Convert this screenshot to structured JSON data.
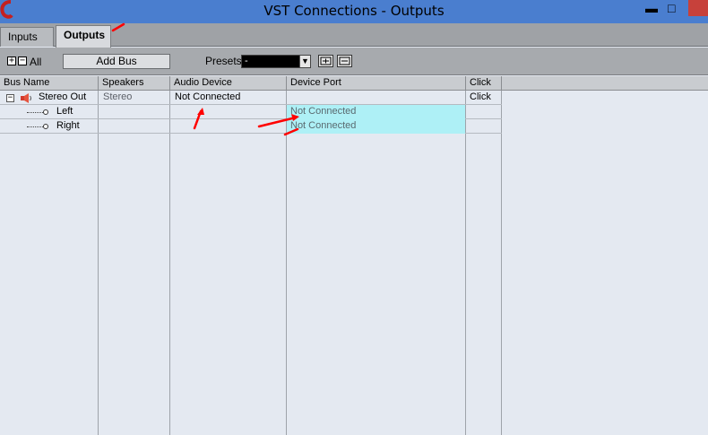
{
  "window": {
    "title": "VST Connections - Outputs",
    "min_glyph": "▬",
    "max_glyph": "□"
  },
  "tabs": [
    {
      "label": "Inputs"
    },
    {
      "label": "Outputs"
    }
  ],
  "toolbar": {
    "expand_glyph": "+",
    "collapse_glyph": "−",
    "all_label": "All",
    "add_bus_label": "Add Bus",
    "presets_label": "Presets",
    "presets_value": "-",
    "dropdown_glyph": "▼"
  },
  "columns": [
    "Bus Name",
    "Speakers",
    "Audio Device",
    "Device Port",
    "Click"
  ],
  "rows": [
    {
      "bus_name": "Stereo Out",
      "speakers": "Stereo",
      "audio_device": "Not Connected",
      "device_port": "",
      "click": "Click",
      "tree_glyph": "−"
    },
    {
      "bus_name": "Left",
      "speakers": "",
      "audio_device": "",
      "device_port": "Not Connected",
      "click": ""
    },
    {
      "bus_name": "Right",
      "speakers": "",
      "audio_device": "",
      "device_port": "Not Connected",
      "click": ""
    }
  ],
  "colors": {
    "titlebar": "#4a7ecf",
    "close": "#c7413b",
    "port_highlight": "#aef0f6",
    "annotation": "#ff0000"
  }
}
